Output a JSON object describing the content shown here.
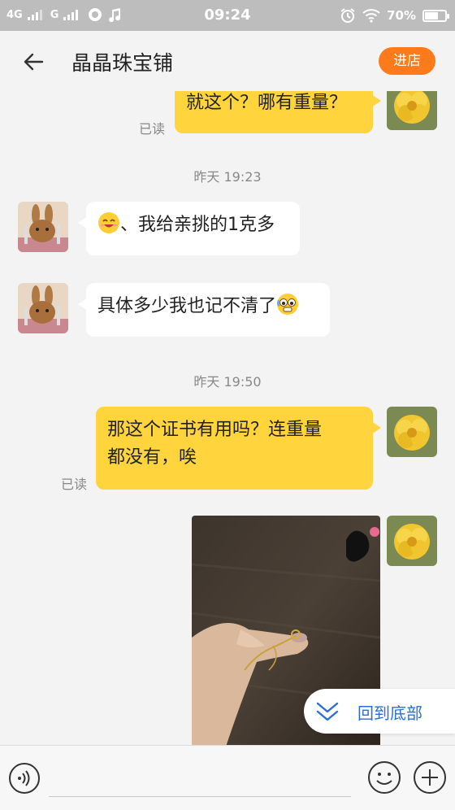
{
  "status_bar": {
    "network1": "4G",
    "network2": "G",
    "time": "09:24",
    "battery": "70%",
    "battery_level": 0.7
  },
  "header": {
    "title": "晶晶珠宝铺",
    "enter_label": "进店"
  },
  "messages": [
    {
      "dir": "out",
      "text": "就这个？哪有重量？",
      "read": "已读"
    },
    {
      "type": "time",
      "text": "昨天 19:23"
    },
    {
      "dir": "in",
      "text": "、我给亲挑的1克多",
      "emoji": "smiling-emoji"
    },
    {
      "dir": "in",
      "text": "具体多少我也记不清了",
      "emoji": "nervous-emoji"
    },
    {
      "type": "time",
      "text": "昨天 19:50"
    },
    {
      "dir": "out",
      "text_line1": "那这个证书有用吗？连重量",
      "text_line2": "都没有，唉",
      "read": "已读"
    },
    {
      "dir": "out",
      "type": "image",
      "image": "ring-photo"
    }
  ],
  "back_to_bottom": "回到底部",
  "input": {
    "placeholder": ""
  },
  "icons": {
    "back": "back-arrow-icon",
    "voice": "voice-icon",
    "emoji": "emoji-icon",
    "plus": "plus-icon",
    "chevron": "double-chevron-down-icon"
  },
  "colors": {
    "accent": "#ff7a1a",
    "bubble_out": "#ffd43d",
    "link": "#2a6fd6"
  }
}
